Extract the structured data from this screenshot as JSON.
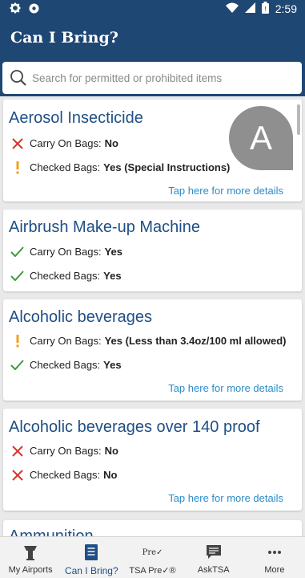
{
  "status_bar": {
    "time": "2:59",
    "icons": [
      "gear-icon",
      "circle-dot-icon",
      "wifi-icon",
      "signal-icon",
      "battery-icon"
    ]
  },
  "app_bar": {
    "title": "Can I Bring?"
  },
  "search": {
    "placeholder": "Search for permitted or prohibited items"
  },
  "colors": {
    "brand": "#1f4773",
    "link": "#2b8cc9",
    "title_blue": "#1f4f86",
    "no_red": "#d9342b",
    "yes_green": "#3b9b3b",
    "warn_orange": "#f0a020"
  },
  "avatar_letter": "A",
  "items": [
    {
      "name": "Aerosol Insecticide",
      "carry_on": {
        "label": "Carry On Bags:",
        "value": "No",
        "status": "no"
      },
      "checked": {
        "label": "Checked Bags:",
        "value": "Yes (Special Instructions)",
        "status": "warn"
      },
      "more": "Tap here for more details"
    },
    {
      "name": "Airbrush Make-up Machine",
      "carry_on": {
        "label": "Carry On Bags:",
        "value": "Yes",
        "status": "yes"
      },
      "checked": {
        "label": "Checked Bags:",
        "value": "Yes",
        "status": "yes"
      },
      "more": ""
    },
    {
      "name": "Alcoholic beverages",
      "carry_on": {
        "label": "Carry On Bags:",
        "value": "Yes (Less than 3.4oz/100 ml allowed)",
        "status": "warn"
      },
      "checked": {
        "label": "Checked Bags:",
        "value": "Yes",
        "status": "yes"
      },
      "more": "Tap here for more details"
    },
    {
      "name": "Alcoholic beverages over 140 proof",
      "carry_on": {
        "label": "Carry On Bags:",
        "value": "No",
        "status": "no"
      },
      "checked": {
        "label": "Checked Bags:",
        "value": "No",
        "status": "no"
      },
      "more": "Tap here for more details"
    },
    {
      "name": "Ammunition"
    }
  ],
  "bottom_nav": [
    {
      "label": "My Airports",
      "icon": "control-tower-icon",
      "active": false
    },
    {
      "label": "Can I Bring?",
      "icon": "document-icon",
      "active": true
    },
    {
      "label": "TSA Pre✓®",
      "icon": "tsa-precheck-icon",
      "logo_text": "Pre✓",
      "active": false
    },
    {
      "label": "AskTSA",
      "icon": "chat-icon",
      "active": false
    },
    {
      "label": "More",
      "icon": "more-dots-icon",
      "active": false
    }
  ]
}
